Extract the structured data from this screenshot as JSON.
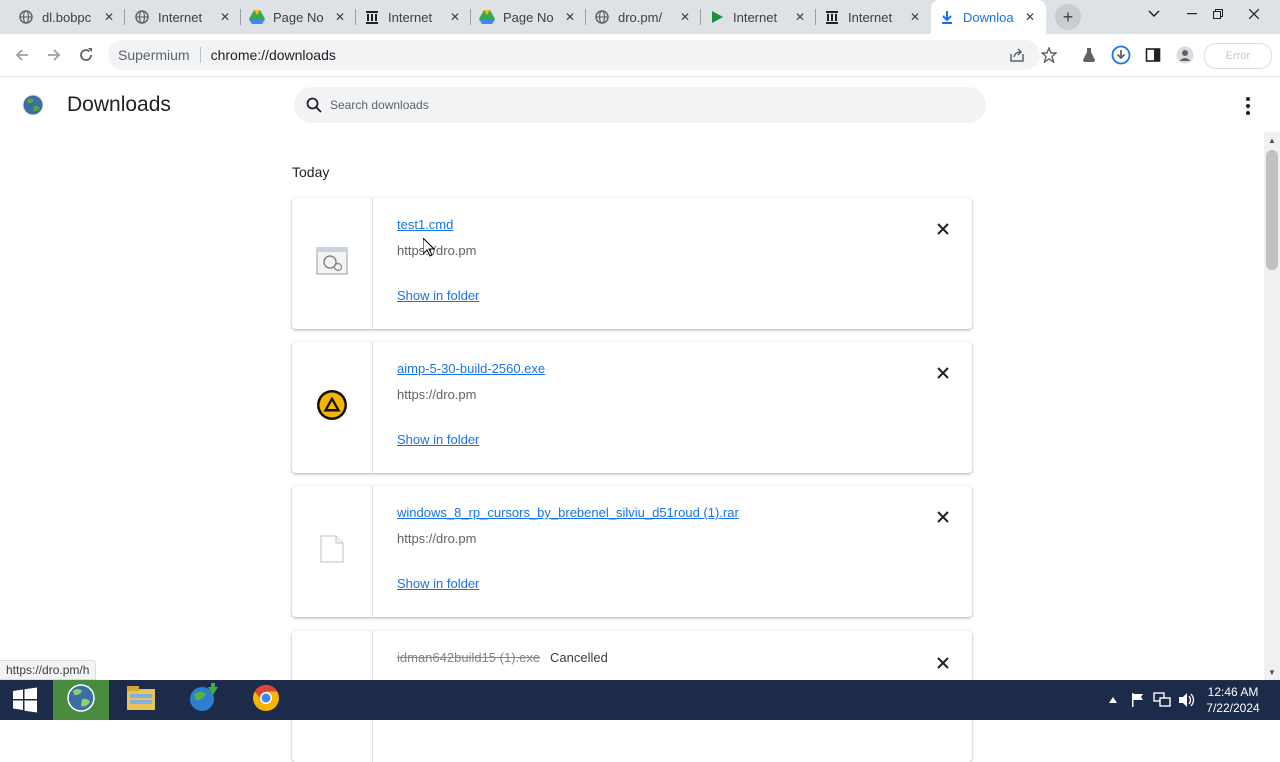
{
  "tabs": [
    {
      "title": "dl.bobpc",
      "icon": "globe-icon"
    },
    {
      "title": "Internet",
      "icon": "globe-icon"
    },
    {
      "title": "Page No",
      "icon": "drive-icon"
    },
    {
      "title": "Internet",
      "icon": "archive-icon"
    },
    {
      "title": "Page No",
      "icon": "drive-icon"
    },
    {
      "title": "dro.pm/",
      "icon": "globe-icon"
    },
    {
      "title": "Internet",
      "icon": "play-icon"
    },
    {
      "title": "Internet",
      "icon": "archive-icon"
    },
    {
      "title": "Downloa",
      "icon": "download-icon"
    }
  ],
  "toolbar": {
    "app_name": "Supermium",
    "url": "chrome://downloads",
    "profile_label": "Error"
  },
  "page": {
    "title": "Downloads",
    "search_placeholder": "Search downloads",
    "section_label": "Today"
  },
  "downloads": [
    {
      "name": "test1.cmd",
      "url": "https://dro.pm",
      "action": "Show in folder",
      "icon": "cmd-file-icon"
    },
    {
      "name": "aimp-5-30-build-2560.exe",
      "url": "https://dro.pm",
      "action": "Show in folder",
      "icon": "aimp-icon"
    },
    {
      "name": "windows_8_rp_cursors_by_brebenel_silviu_d51roud (1).rar",
      "url": "https://dro.pm",
      "action": "Show in folder",
      "icon": "generic-file-icon"
    },
    {
      "name": "idman642build15 (1).exe",
      "status": "Cancelled"
    }
  ],
  "status_bar": "https://dro.pm/h",
  "taskbar": {
    "time": "12:46 AM",
    "date": "7/22/2024"
  },
  "colors": {
    "link": "#1a73e8",
    "tabstrip": "#dee1e6",
    "taskbar": "#1c2b49"
  }
}
